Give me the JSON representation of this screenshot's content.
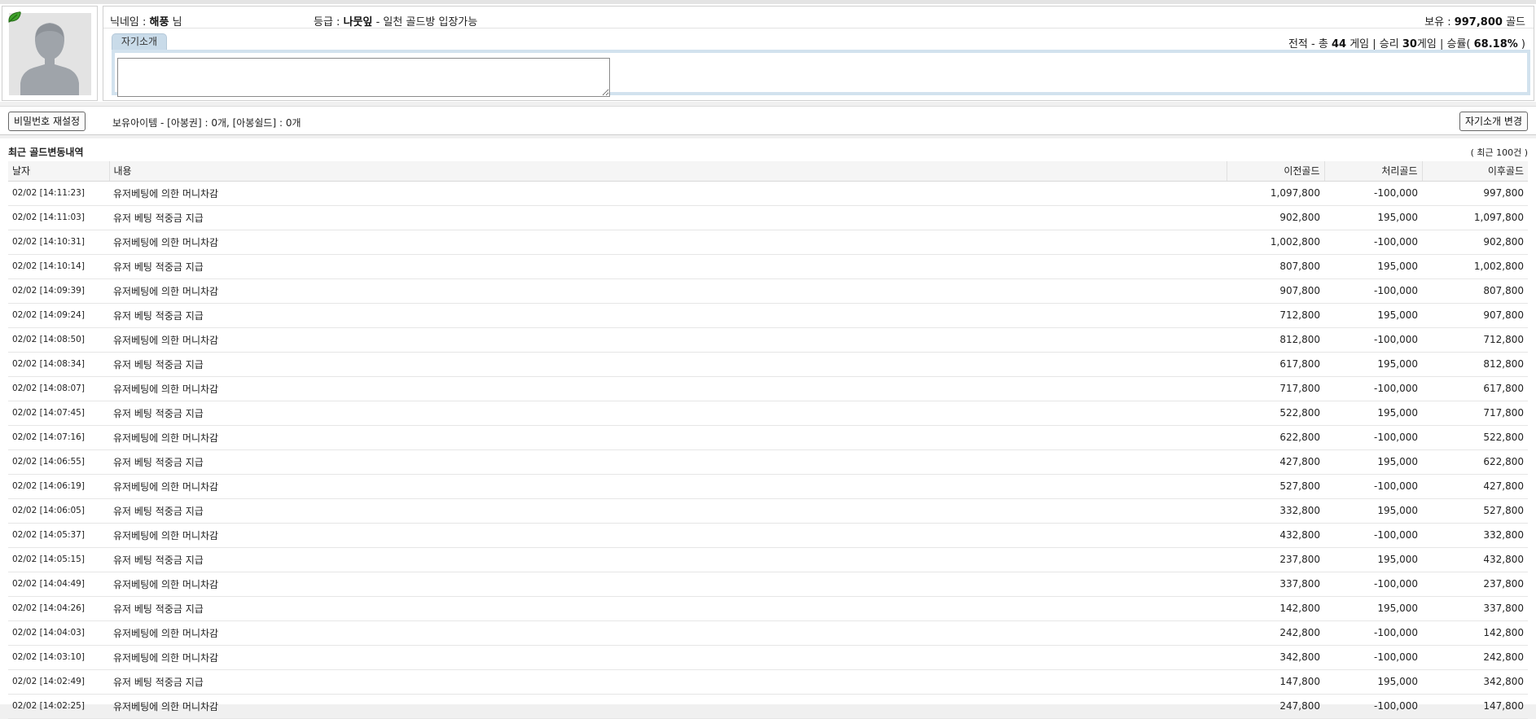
{
  "profile": {
    "nickname_label": "닉네임 :",
    "nickname": "해풍",
    "nickname_suffix": "님",
    "grade_label": "등급 :",
    "grade": "나뭇잎",
    "grade_desc": "- 일천 골드방 입장가능",
    "gold_label": "보유 :",
    "gold": "997,800",
    "gold_unit": "골드",
    "intro_tab_label": "자기소개",
    "intro_value": "",
    "record": {
      "prefix": "전적 - 총",
      "total": "44",
      "games_label": "게임 | 승리",
      "wins": "30",
      "wins_label": "게임 | 승률(",
      "rate": "68.18%",
      "suffix": ")"
    }
  },
  "actions": {
    "reset_password_label": "비밀번호 재설정",
    "items_text": "보유아이템 - [아봉권] : 0개, [아봉쉴드] : 0개",
    "change_intro_label": "자기소개 변경"
  },
  "history": {
    "title": "최근 골드변동내역",
    "count_note": "( 최근 100건 )",
    "columns": [
      "날자",
      "내용",
      "이전골드",
      "처리골드",
      "이후골드"
    ],
    "rows": [
      {
        "date": "02/02 [14:11:23]",
        "desc": "유저베팅에 의한 머니차감",
        "before": "1,097,800",
        "change": "-100,000",
        "after": "997,800"
      },
      {
        "date": "02/02 [14:11:03]",
        "desc": "유저 베팅 적중금 지급",
        "before": "902,800",
        "change": "195,000",
        "after": "1,097,800"
      },
      {
        "date": "02/02 [14:10:31]",
        "desc": "유저베팅에 의한 머니차감",
        "before": "1,002,800",
        "change": "-100,000",
        "after": "902,800"
      },
      {
        "date": "02/02 [14:10:14]",
        "desc": "유저 베팅 적중금 지급",
        "before": "807,800",
        "change": "195,000",
        "after": "1,002,800"
      },
      {
        "date": "02/02 [14:09:39]",
        "desc": "유저베팅에 의한 머니차감",
        "before": "907,800",
        "change": "-100,000",
        "after": "807,800"
      },
      {
        "date": "02/02 [14:09:24]",
        "desc": "유저 베팅 적중금 지급",
        "before": "712,800",
        "change": "195,000",
        "after": "907,800"
      },
      {
        "date": "02/02 [14:08:50]",
        "desc": "유저베팅에 의한 머니차감",
        "before": "812,800",
        "change": "-100,000",
        "after": "712,800"
      },
      {
        "date": "02/02 [14:08:34]",
        "desc": "유저 베팅 적중금 지급",
        "before": "617,800",
        "change": "195,000",
        "after": "812,800"
      },
      {
        "date": "02/02 [14:08:07]",
        "desc": "유저베팅에 의한 머니차감",
        "before": "717,800",
        "change": "-100,000",
        "after": "617,800"
      },
      {
        "date": "02/02 [14:07:45]",
        "desc": "유저 베팅 적중금 지급",
        "before": "522,800",
        "change": "195,000",
        "after": "717,800"
      },
      {
        "date": "02/02 [14:07:16]",
        "desc": "유저베팅에 의한 머니차감",
        "before": "622,800",
        "change": "-100,000",
        "after": "522,800"
      },
      {
        "date": "02/02 [14:06:55]",
        "desc": "유저 베팅 적중금 지급",
        "before": "427,800",
        "change": "195,000",
        "after": "622,800"
      },
      {
        "date": "02/02 [14:06:19]",
        "desc": "유저베팅에 의한 머니차감",
        "before": "527,800",
        "change": "-100,000",
        "after": "427,800"
      },
      {
        "date": "02/02 [14:06:05]",
        "desc": "유저 베팅 적중금 지급",
        "before": "332,800",
        "change": "195,000",
        "after": "527,800"
      },
      {
        "date": "02/02 [14:05:37]",
        "desc": "유저베팅에 의한 머니차감",
        "before": "432,800",
        "change": "-100,000",
        "after": "332,800"
      },
      {
        "date": "02/02 [14:05:15]",
        "desc": "유저 베팅 적중금 지급",
        "before": "237,800",
        "change": "195,000",
        "after": "432,800"
      },
      {
        "date": "02/02 [14:04:49]",
        "desc": "유저베팅에 의한 머니차감",
        "before": "337,800",
        "change": "-100,000",
        "after": "237,800"
      },
      {
        "date": "02/02 [14:04:26]",
        "desc": "유저 베팅 적중금 지급",
        "before": "142,800",
        "change": "195,000",
        "after": "337,800"
      },
      {
        "date": "02/02 [14:04:03]",
        "desc": "유저베팅에 의한 머니차감",
        "before": "242,800",
        "change": "-100,000",
        "after": "142,800"
      },
      {
        "date": "02/02 [14:03:10]",
        "desc": "유저베팅에 의한 머니차감",
        "before": "342,800",
        "change": "-100,000",
        "after": "242,800"
      },
      {
        "date": "02/02 [14:02:49]",
        "desc": "유저 베팅 적중금 지급",
        "before": "147,800",
        "change": "195,000",
        "after": "342,800"
      },
      {
        "date": "02/02 [14:02:25]",
        "desc": "유저베팅에 의한 머니차감",
        "before": "247,800",
        "change": "-100,000",
        "after": "147,800"
      }
    ]
  }
}
